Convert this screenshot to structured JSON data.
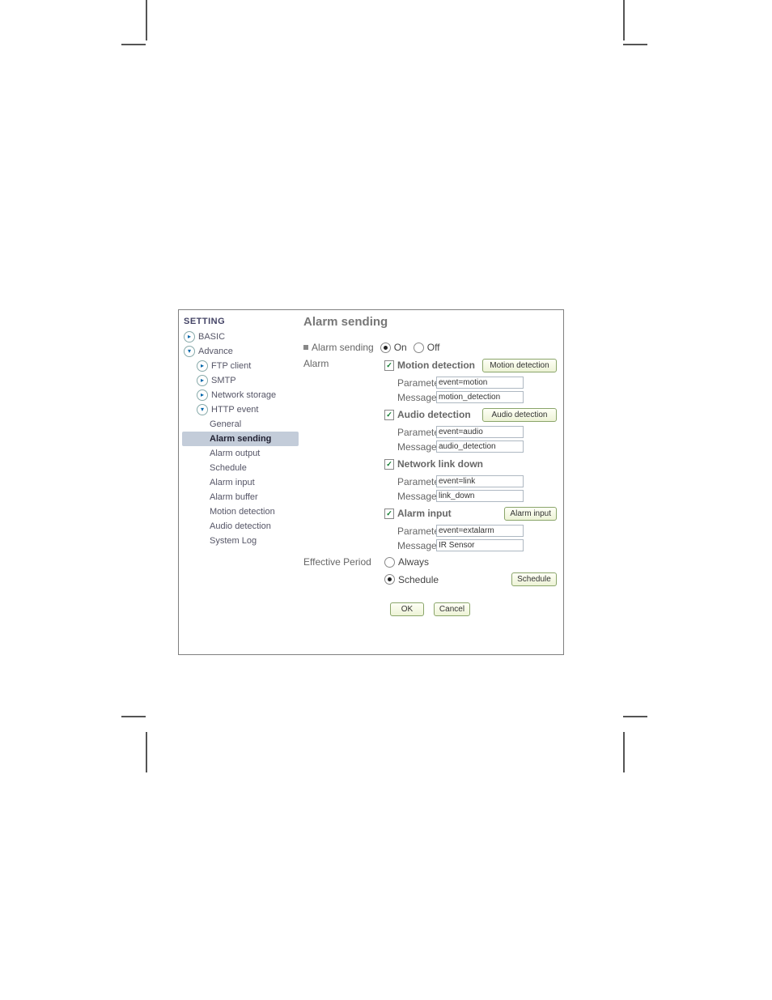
{
  "sidebar": {
    "title": "SETTING",
    "items": [
      {
        "label": "BASIC",
        "level": 1,
        "icon": true
      },
      {
        "label": "Advance",
        "level": 1,
        "icon": true,
        "open": true
      },
      {
        "label": "FTP client",
        "level": 2,
        "icon": true
      },
      {
        "label": "SMTP",
        "level": 2,
        "icon": true
      },
      {
        "label": "Network storage",
        "level": 2,
        "icon": true
      },
      {
        "label": "HTTP event",
        "level": 2,
        "icon": true,
        "open": true
      },
      {
        "label": "General",
        "level": 3
      },
      {
        "label": "Alarm sending",
        "level": 3,
        "selected": true
      },
      {
        "label": "Alarm output",
        "level": 3
      },
      {
        "label": "Schedule",
        "level": 3
      },
      {
        "label": "Alarm input",
        "level": 3
      },
      {
        "label": "Alarm buffer",
        "level": 3
      },
      {
        "label": "Motion detection",
        "level": 3
      },
      {
        "label": "Audio detection",
        "level": 3
      },
      {
        "label": "System Log",
        "level": 3
      }
    ]
  },
  "main": {
    "title": "Alarm sending",
    "toggle": {
      "label": "Alarm sending",
      "on": "On",
      "off": "Off",
      "value": "On"
    },
    "alarmLabel": "Alarm",
    "paramLabel": "Parameter",
    "msgLabel": "Message",
    "groups": [
      {
        "name": "Motion detection",
        "checked": true,
        "button": "Motion detection",
        "parameter": "event=motion",
        "message": "motion_detection"
      },
      {
        "name": "Audio detection",
        "checked": true,
        "button": "Audio detection",
        "parameter": "event=audio",
        "message": "audio_detection"
      },
      {
        "name": "Network link down",
        "checked": true,
        "button": null,
        "parameter": "event=link",
        "message": "link_down"
      },
      {
        "name": "Alarm input",
        "checked": true,
        "button": "Alarm input",
        "parameter": "event=extalarm",
        "message": "IR Sensor"
      }
    ],
    "effective": {
      "label": "Effective Period",
      "always": "Always",
      "schedule": "Schedule",
      "scheduleBtn": "Schedule",
      "value": "Schedule"
    },
    "buttons": {
      "ok": "OK",
      "cancel": "Cancel"
    }
  }
}
